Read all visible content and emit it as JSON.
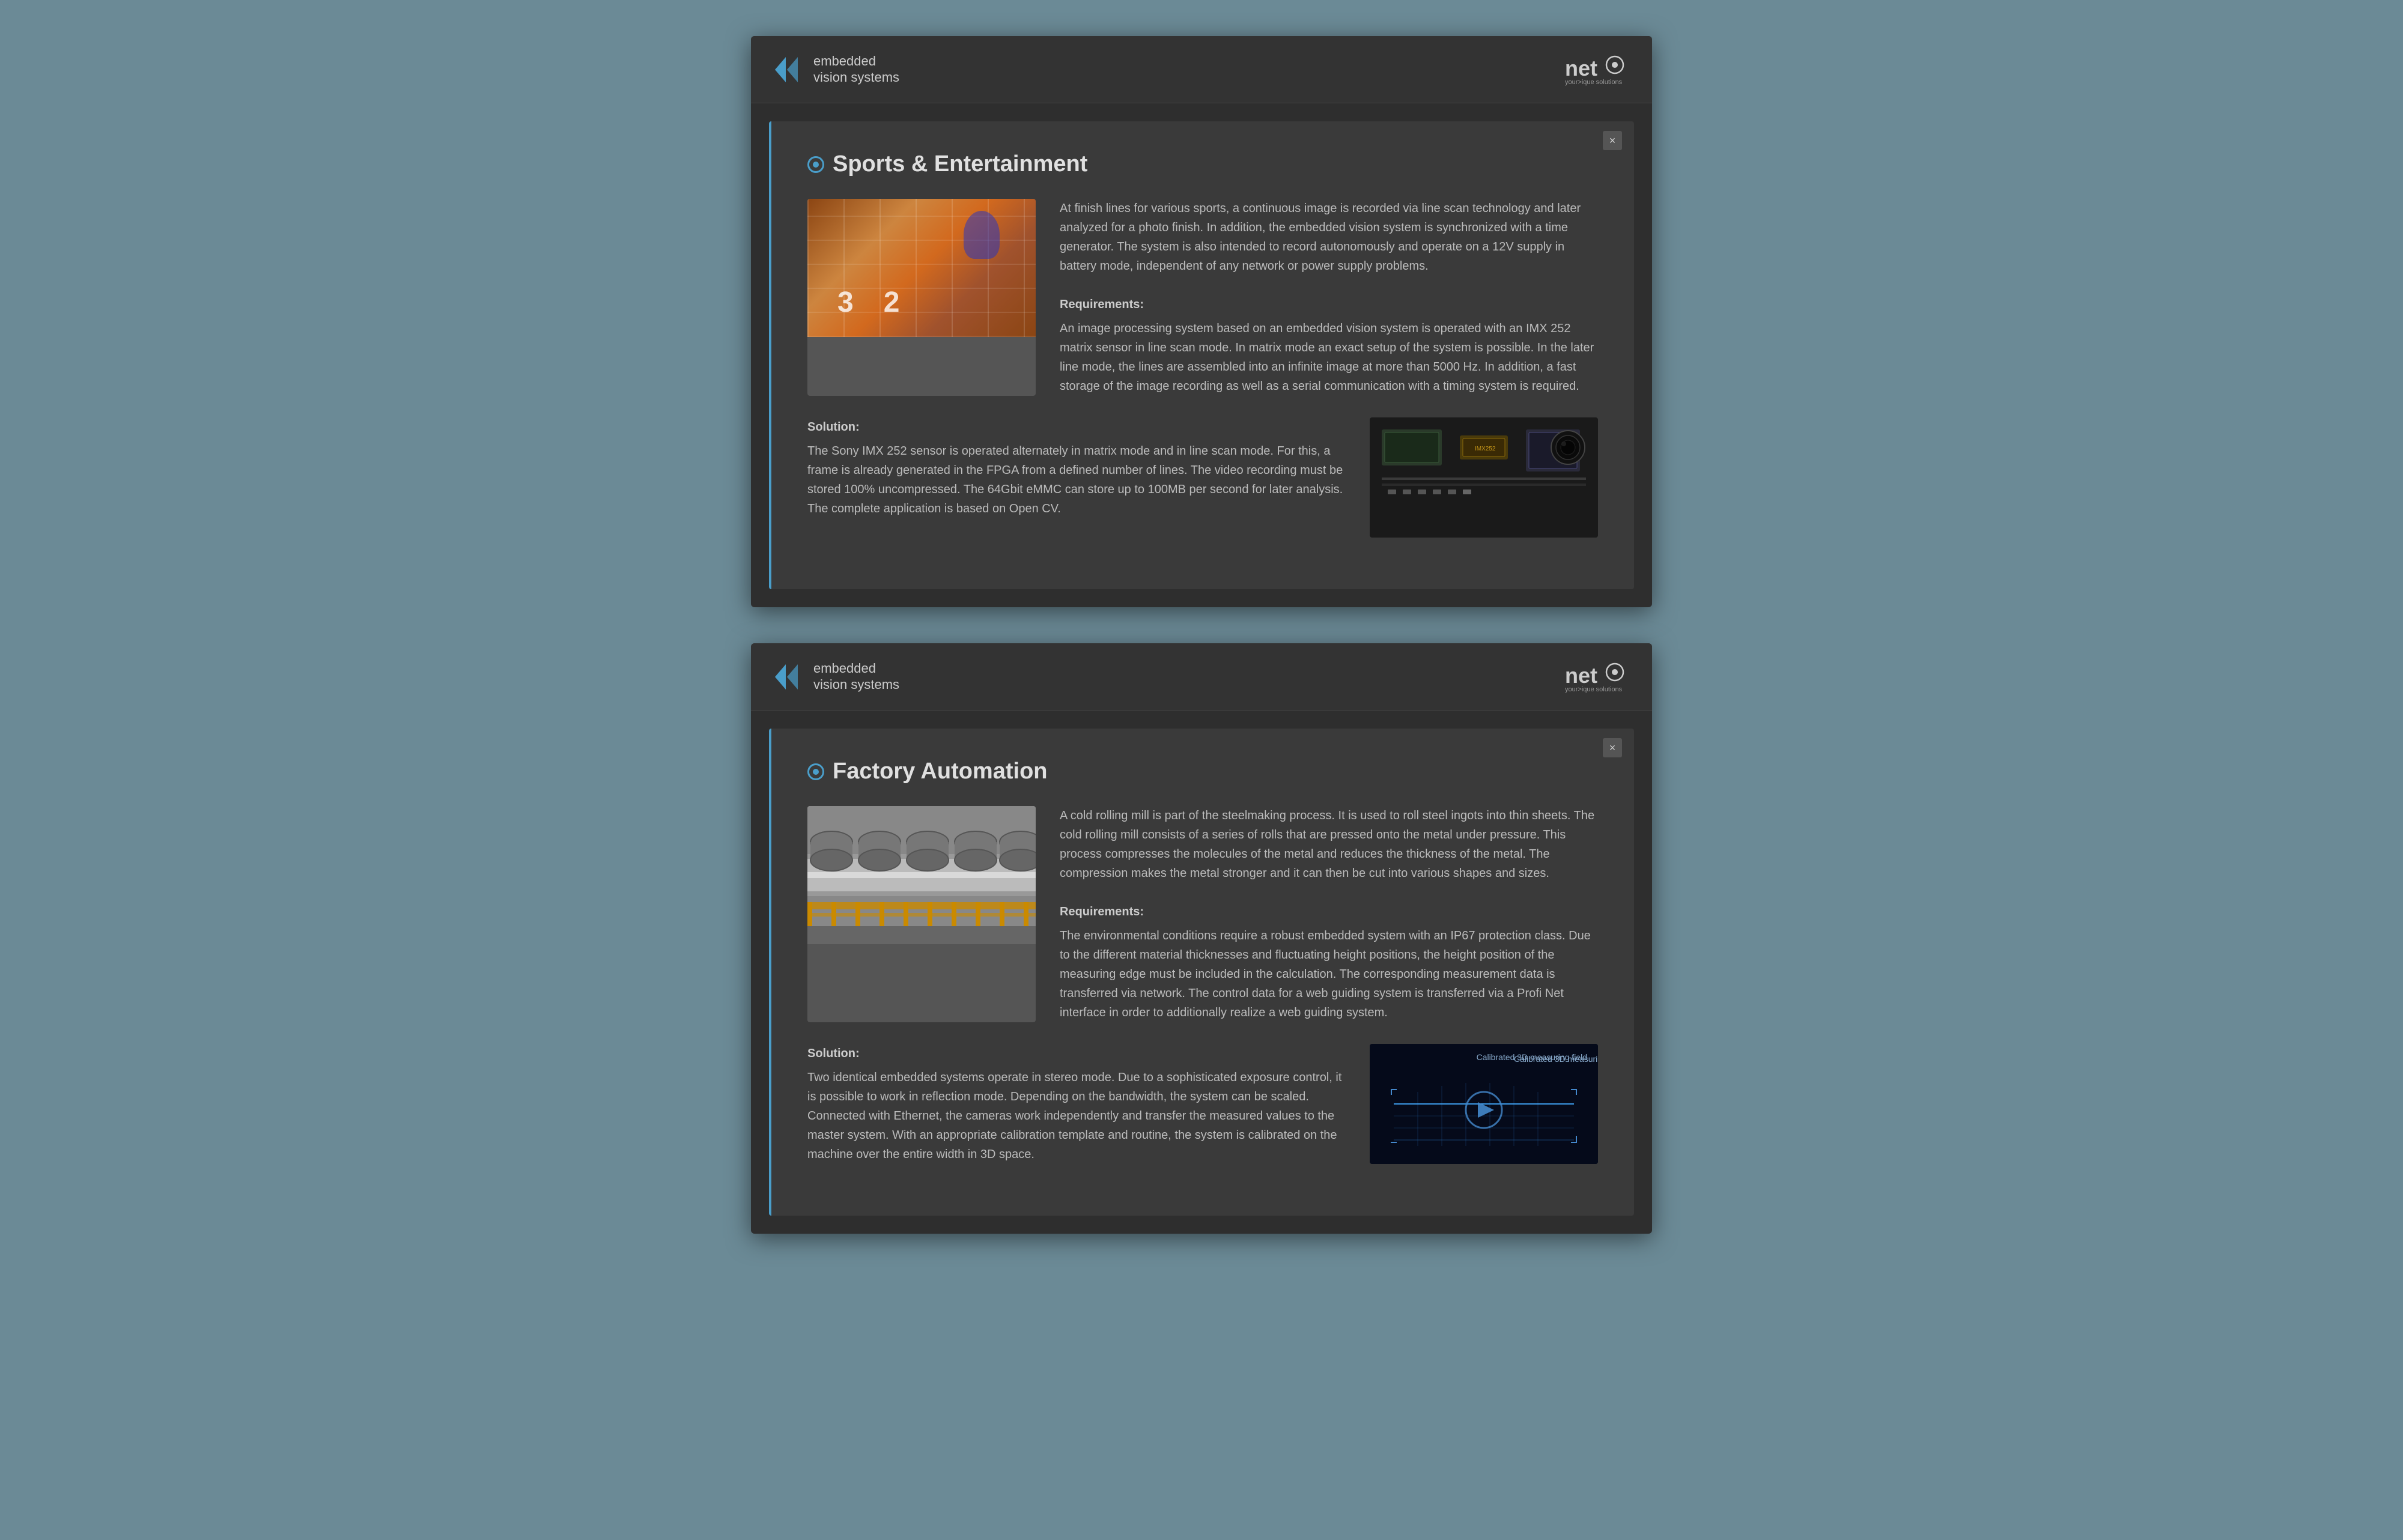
{
  "card1": {
    "brand": {
      "line1": "embedded",
      "line2": "vision systems"
    },
    "title": "Sports & Entertainment",
    "description": "At finish lines for various sports, a continuous image is recorded via line scan technology and later analyzed for a photo finish. In addition, the embedded vision system is synchronized with a time generator. The system is also intended to record autonomously and operate on a 12V supply in battery mode, independent of any network or power supply problems.",
    "requirements_label": "Requirements:",
    "requirements_text": "An image processing system based on an embedded vision system is operated with an IMX 252 matrix sensor in line scan mode. In matrix mode an exact setup of the system is possible. In the later line mode, the lines are assembled into an infinite image at more than 5000 Hz. In addition, a fast storage of the image recording as well as a serial communication with a timing system is required.",
    "solution_label": "Solution:",
    "solution_text": "The Sony IMX 252 sensor is operated alternately in matrix mode and in line scan mode. For this, a frame is already generated in the FPGA from a defined number of lines. The video recording must be stored 100% uncompressed. The 64Gbit eMMC can store up to 100MB per second for later analysis. The complete application is based on Open CV.",
    "close": "×"
  },
  "card2": {
    "brand": {
      "line1": "embedded",
      "line2": "vision systems"
    },
    "title": "Factory Automation",
    "description": "A cold rolling mill is part of the steelmaking process. It is used to roll steel ingots into thin sheets. The cold rolling mill consists of a series of rolls that are pressed onto the metal under pressure. This process compresses the molecules of the metal and reduces the thickness of the metal. The compression makes the metal stronger and it can then be cut into various shapes and sizes.",
    "requirements_label": "Requirements:",
    "requirements_text": "The environmental conditions require a robust embedded system with an IP67 protection class. Due to the different material thicknesses and fluctuating height positions, the height position of the measuring edge must be included in the calculation. The corresponding measurement data is transferred via network. The control data for a web guiding system is transferred via a Profi Net interface in order to additionally realize a web guiding system.",
    "solution_label": "Solution:",
    "solution_text": "Two identical embedded systems operate in stereo mode. Due to a sophisticated exposure control, it is possible to work in reflection mode. Depending on the bandwidth, the system can be scaled. Connected with Ethernet, the cameras work independently and transfer the measured values to the master system. With an appropriate calibration template and routine, the system is calibrated on the machine over the entire width in 3D space.",
    "viz_label": "Calibrated 3D measuring field",
    "close": "×"
  }
}
